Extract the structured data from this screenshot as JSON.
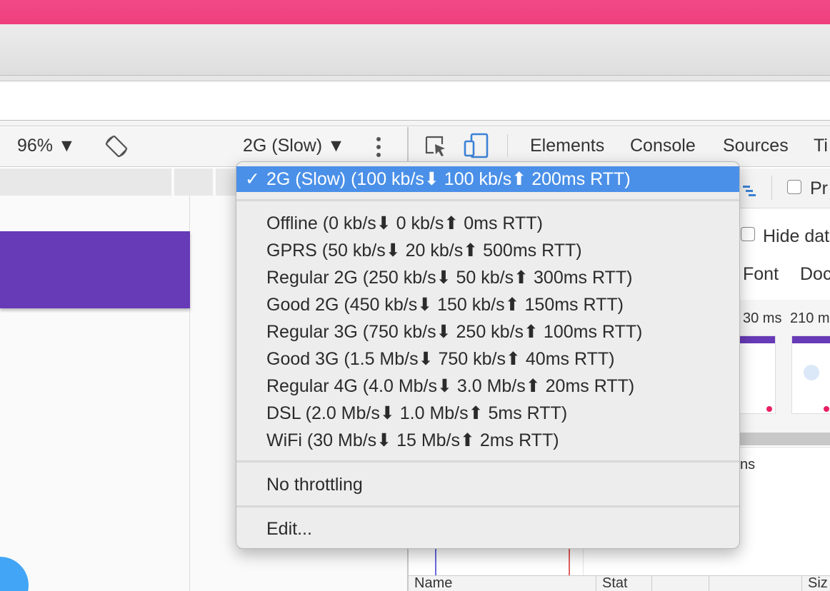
{
  "toolbar": {
    "zoom": "96% ▼",
    "throttle": "2G (Slow) ▼"
  },
  "devtools": {
    "tabs": [
      "Elements",
      "Console",
      "Sources",
      "Ti"
    ]
  },
  "panel": {
    "pre_label": "Pr",
    "hide_label": "Hide dat",
    "font_label": "Font",
    "doc_label": "Doc",
    "time1": "30 ms",
    "time2": "210 m",
    "ns_label": "ns",
    "columns": [
      "Name",
      "Stat",
      "",
      "",
      "Siz"
    ]
  },
  "menu": {
    "selected": "2G (Slow) (100 kb/s⬇ 100 kb/s⬆ 200ms RTT)",
    "check": "✓",
    "presets": [
      "Offline (0 kb/s⬇ 0 kb/s⬆ 0ms RTT)",
      "GPRS (50 kb/s⬇ 20 kb/s⬆ 500ms RTT)",
      "Regular 2G (250 kb/s⬇ 50 kb/s⬆ 300ms RTT)",
      "Good 2G (450 kb/s⬇ 150 kb/s⬆ 150ms RTT)",
      "Regular 3G (750 kb/s⬇ 250 kb/s⬆ 100ms RTT)",
      "Good 3G (1.5 Mb/s⬇ 750 kb/s⬆ 40ms RTT)",
      "Regular 4G (4.0 Mb/s⬇ 3.0 Mb/s⬆ 20ms RTT)",
      "DSL (2.0 Mb/s⬇ 1.0 Mb/s⬆ 5ms RTT)",
      "WiFi (30 Mb/s⬇ 15 Mb/s⬆ 2ms RTT)"
    ],
    "no_throttling": "No throttling",
    "edit": "Edit..."
  },
  "colors": {
    "brand_pink": "#ee3f7c",
    "app_header": "#673ab7",
    "selection": "#4a90e8",
    "active_icon": "#3b82d6"
  },
  "icons": [
    "rotate-icon",
    "more-vertical-icon",
    "inspect-element-icon",
    "device-toolbar-icon"
  ]
}
